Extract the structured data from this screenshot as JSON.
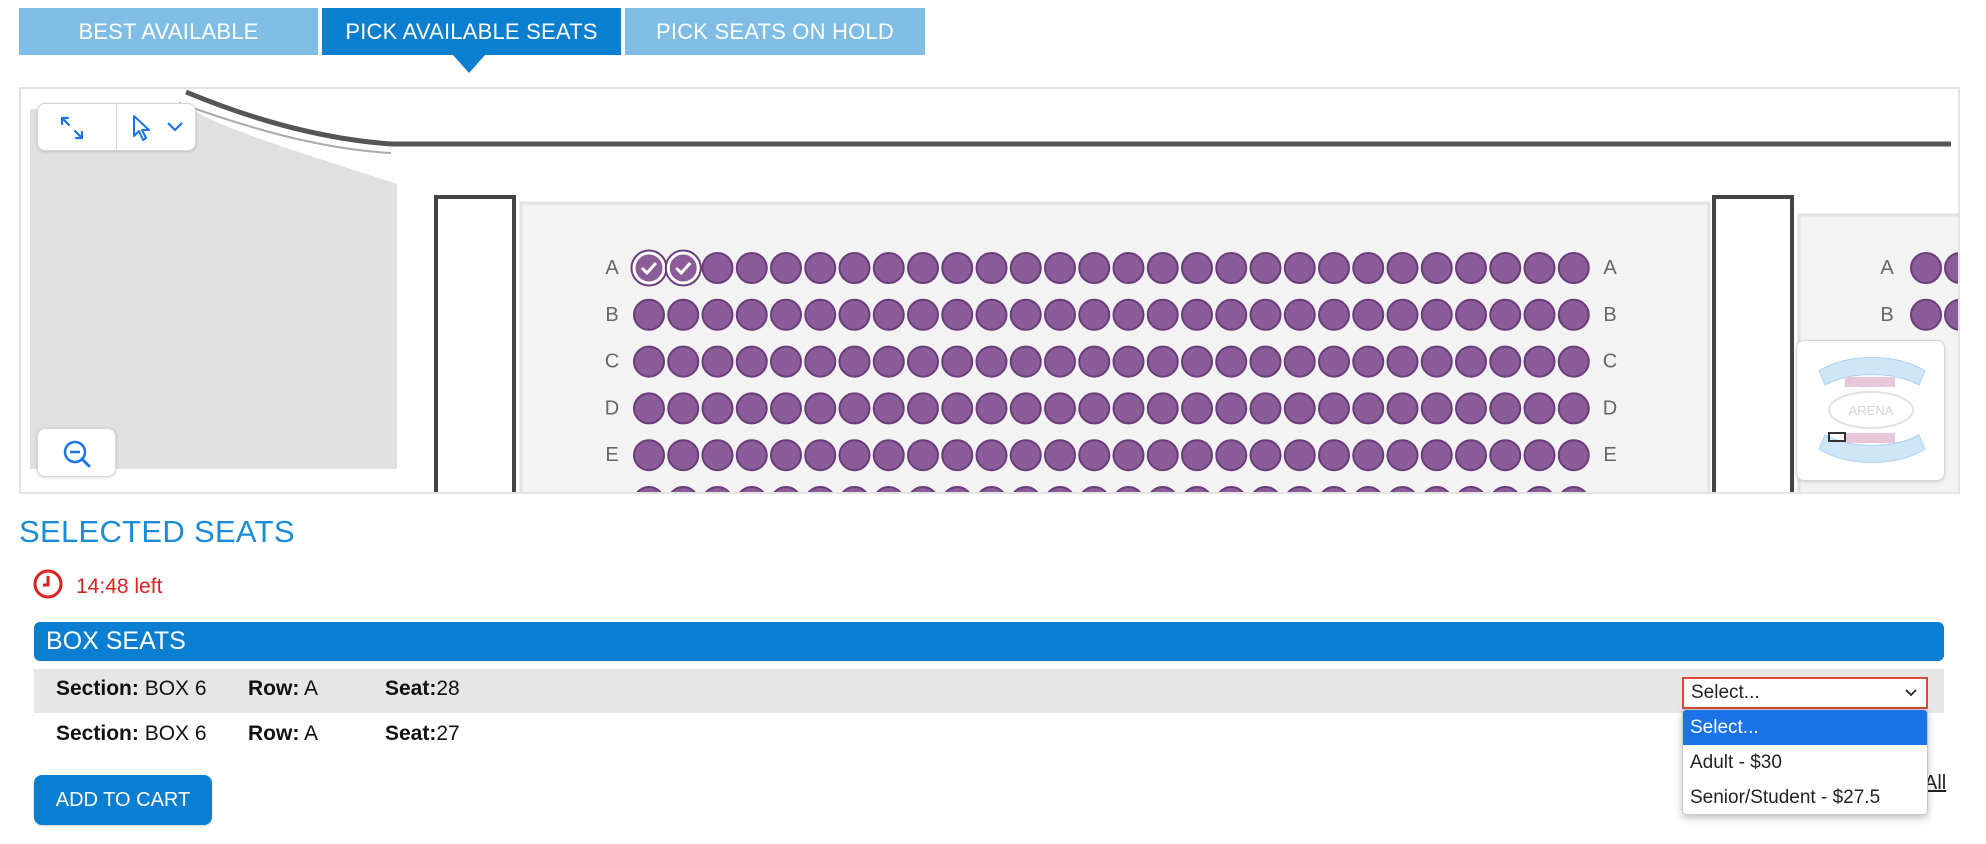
{
  "tabs": [
    {
      "label": "BEST AVAILABLE",
      "active": false
    },
    {
      "label": "PICK AVAILABLE SEATS",
      "active": true
    },
    {
      "label": "PICK SEATS ON HOLD",
      "active": false
    }
  ],
  "seat_map": {
    "rows": [
      "A",
      "B",
      "C",
      "D",
      "E"
    ],
    "seats_per_row": 28,
    "selected": [
      {
        "row": "A",
        "seat": 1
      },
      {
        "row": "A",
        "seat": 2
      }
    ],
    "right_section_rows": [
      "A",
      "B"
    ],
    "minimap_label": "ARENA",
    "colors": {
      "seat": "#8a5c98",
      "seat_border": "#6a3d7a",
      "selected_fill": "#ffffff"
    }
  },
  "selected_seats": {
    "title": "SELECTED SEATS",
    "timer": "14:48 left",
    "section_header": "BOX SEATS",
    "seats": [
      {
        "section_label": "Section:",
        "section": "BOX 6",
        "row_label": "Row:",
        "row": "A",
        "seat_label": "Seat:",
        "seat": "28"
      },
      {
        "section_label": "Section:",
        "section": "BOX 6",
        "row_label": "Row:",
        "row": "A",
        "seat_label": "Seat:",
        "seat": "27"
      }
    ]
  },
  "price_select": {
    "value": "Select...",
    "options": [
      "Select...",
      "Adult - $30",
      "Senior/Student - $27.5"
    ],
    "highlighted": "Select..."
  },
  "clear_link": "All",
  "add_to_cart": "ADD TO CART"
}
